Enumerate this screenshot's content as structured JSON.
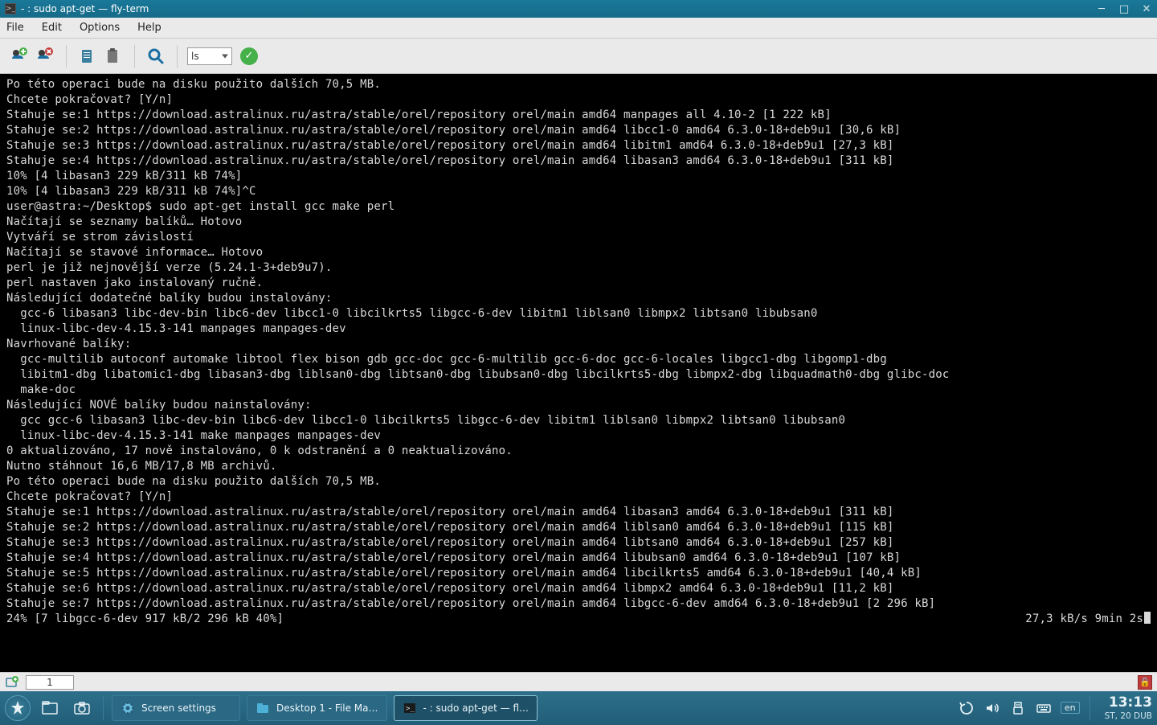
{
  "window": {
    "title": "- : sudo apt-get — fly-term"
  },
  "menu": {
    "file": "File",
    "edit": "Edit",
    "options": "Options",
    "help": "Help"
  },
  "toolbar": {
    "combo_value": "ls"
  },
  "terminal": {
    "lines": [
      "Po této operaci bude na disku použito dalších 70,5 MB.",
      "Chcete pokračovat? [Y/n]",
      "Stahuje se:1 https://download.astralinux.ru/astra/stable/orel/repository orel/main amd64 manpages all 4.10-2 [1 222 kB]",
      "Stahuje se:2 https://download.astralinux.ru/astra/stable/orel/repository orel/main amd64 libcc1-0 amd64 6.3.0-18+deb9u1 [30,6 kB]",
      "Stahuje se:3 https://download.astralinux.ru/astra/stable/orel/repository orel/main amd64 libitm1 amd64 6.3.0-18+deb9u1 [27,3 kB]",
      "Stahuje se:4 https://download.astralinux.ru/astra/stable/orel/repository orel/main amd64 libasan3 amd64 6.3.0-18+deb9u1 [311 kB]",
      "10% [4 libasan3 229 kB/311 kB 74%]",
      "10% [4 libasan3 229 kB/311 kB 74%]^C",
      "user@astra:~/Desktop$ sudo apt-get install gcc make perl",
      "Načítají se seznamy balíků… Hotovo",
      "Vytváří se strom závislostí",
      "Načítají se stavové informace… Hotovo",
      "perl je již nejnovější verze (5.24.1-3+deb9u7).",
      "perl nastaven jako instalovaný ručně.",
      "Následující dodatečné balíky budou instalovány:",
      "  gcc-6 libasan3 libc-dev-bin libc6-dev libcc1-0 libcilkrts5 libgcc-6-dev libitm1 liblsan0 libmpx2 libtsan0 libubsan0",
      "  linux-libc-dev-4.15.3-141 manpages manpages-dev",
      "Navrhované balíky:",
      "  gcc-multilib autoconf automake libtool flex bison gdb gcc-doc gcc-6-multilib gcc-6-doc gcc-6-locales libgcc1-dbg libgomp1-dbg",
      "  libitm1-dbg libatomic1-dbg libasan3-dbg liblsan0-dbg libtsan0-dbg libubsan0-dbg libcilkrts5-dbg libmpx2-dbg libquadmath0-dbg glibc-doc",
      "  make-doc",
      "Následující NOVÉ balíky budou nainstalovány:",
      "  gcc gcc-6 libasan3 libc-dev-bin libc6-dev libcc1-0 libcilkrts5 libgcc-6-dev libitm1 liblsan0 libmpx2 libtsan0 libubsan0",
      "  linux-libc-dev-4.15.3-141 make manpages manpages-dev",
      "0 aktualizováno, 17 nově instalováno, 0 k odstranění a 0 neaktualizováno.",
      "Nutno stáhnout 16,6 MB/17,8 MB archivů.",
      "Po této operaci bude na disku použito dalších 70,5 MB.",
      "Chcete pokračovat? [Y/n]",
      "Stahuje se:1 https://download.astralinux.ru/astra/stable/orel/repository orel/main amd64 libasan3 amd64 6.3.0-18+deb9u1 [311 kB]",
      "Stahuje se:2 https://download.astralinux.ru/astra/stable/orel/repository orel/main amd64 liblsan0 amd64 6.3.0-18+deb9u1 [115 kB]",
      "Stahuje se:3 https://download.astralinux.ru/astra/stable/orel/repository orel/main amd64 libtsan0 amd64 6.3.0-18+deb9u1 [257 kB]",
      "Stahuje se:4 https://download.astralinux.ru/astra/stable/orel/repository orel/main amd64 libubsan0 amd64 6.3.0-18+deb9u1 [107 kB]",
      "Stahuje se:5 https://download.astralinux.ru/astra/stable/orel/repository orel/main amd64 libcilkrts5 amd64 6.3.0-18+deb9u1 [40,4 kB]",
      "Stahuje se:6 https://download.astralinux.ru/astra/stable/orel/repository orel/main amd64 libmpx2 amd64 6.3.0-18+deb9u1 [11,2 kB]",
      "Stahuje se:7 https://download.astralinux.ru/astra/stable/orel/repository orel/main amd64 libgcc-6-dev amd64 6.3.0-18+deb9u1 [2 296 kB]"
    ],
    "last_left": "24% [7 libgcc-6-dev 917 kB/2 296 kB 40%]",
    "last_right": "27,3 kB/s 9min 2s"
  },
  "statusbar": {
    "tab": "1"
  },
  "taskbar": {
    "screen_settings": "Screen settings",
    "file_manager": "Desktop 1 - File Ma…",
    "terminal": "- : sudo apt-get — fl…",
    "lang": "en",
    "time": "13:13",
    "date": "ST, 20 DUB"
  }
}
